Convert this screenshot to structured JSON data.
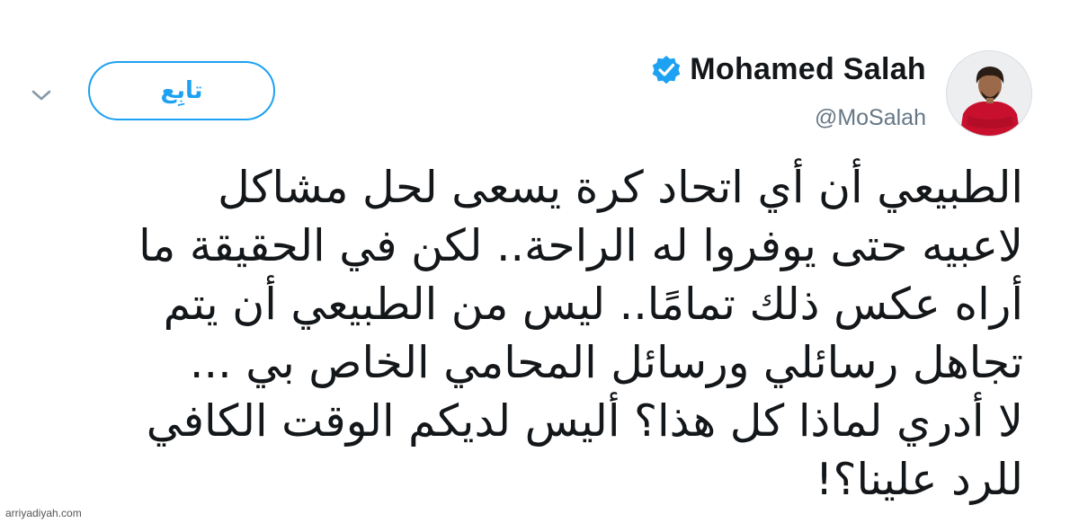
{
  "header": {
    "follow_label": "تابِع",
    "display_name": "Mohamed Salah",
    "handle": "@MoSalah",
    "verified": true
  },
  "icons": {
    "menu": "chevron-down-icon",
    "verified": "verified-badge-icon",
    "avatar": "profile-photo"
  },
  "colors": {
    "accent": "#1da1f2",
    "text": "#14171a",
    "muted": "#657786",
    "jersey": "#c8102e"
  },
  "tweet": {
    "lines": [
      "الطبيعي أن أي اتحاد كرة يسعى لحل مشاكل",
      "لاعبيه حتى يوفروا له الراحة.. لكن في الحقيقة ما",
      "أراه عكس ذلك تمامًا.. ليس من الطبيعي أن يتم",
      "تجاهل رسائلي ورسائل المحامي الخاص بي ...",
      "لا أدري لماذا كل هذا؟ أليس لديكم الوقت الكافي",
      "للرد علينا؟!"
    ]
  },
  "footer": {
    "watermark": "arriyadiyah.com"
  }
}
